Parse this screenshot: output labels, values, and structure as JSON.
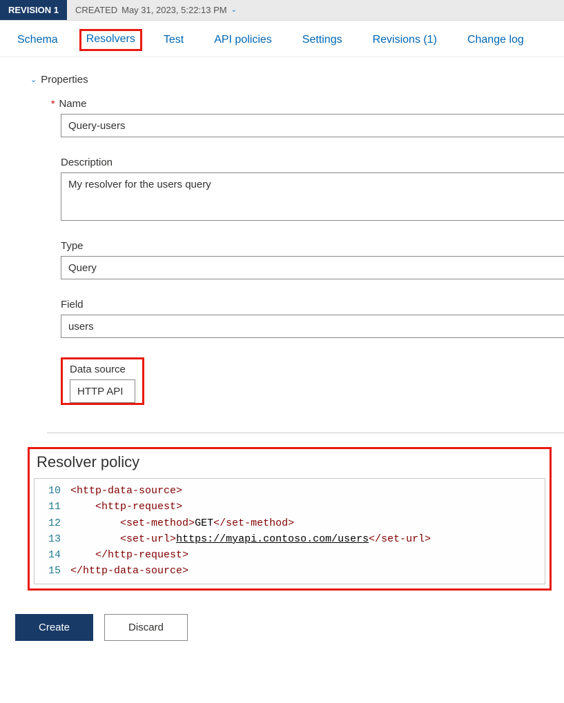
{
  "revision": {
    "badge": "REVISION 1",
    "created_label": "CREATED",
    "created_ts": "May 31, 2023, 5:22:13 PM"
  },
  "tabs": {
    "schema": "Schema",
    "resolvers": "Resolvers",
    "test": "Test",
    "api_policies": "API policies",
    "settings": "Settings",
    "revisions": "Revisions (1)",
    "change_log": "Change log"
  },
  "section": {
    "properties": "Properties"
  },
  "form": {
    "name_label": "Name",
    "name_value": "Query-users",
    "description_label": "Description",
    "description_value": "My resolver for the users query",
    "type_label": "Type",
    "type_value": "Query",
    "field_label": "Field",
    "field_value": "users",
    "data_source_label": "Data source",
    "data_source_value": "HTTP API"
  },
  "policy": {
    "title": "Resolver policy",
    "lines": [
      {
        "n": 10,
        "indent": 0,
        "kind": "open",
        "tag": "http-data-source"
      },
      {
        "n": 11,
        "indent": 1,
        "kind": "open",
        "tag": "http-request"
      },
      {
        "n": 12,
        "indent": 2,
        "kind": "elem",
        "tag": "set-method",
        "text": "GET"
      },
      {
        "n": 13,
        "indent": 2,
        "kind": "url",
        "tag": "set-url",
        "text": "https://myapi.contoso.com/users"
      },
      {
        "n": 14,
        "indent": 1,
        "kind": "close",
        "tag": "http-request"
      },
      {
        "n": 15,
        "indent": 0,
        "kind": "close",
        "tag": "http-data-source"
      }
    ]
  },
  "buttons": {
    "create": "Create",
    "discard": "Discard"
  }
}
